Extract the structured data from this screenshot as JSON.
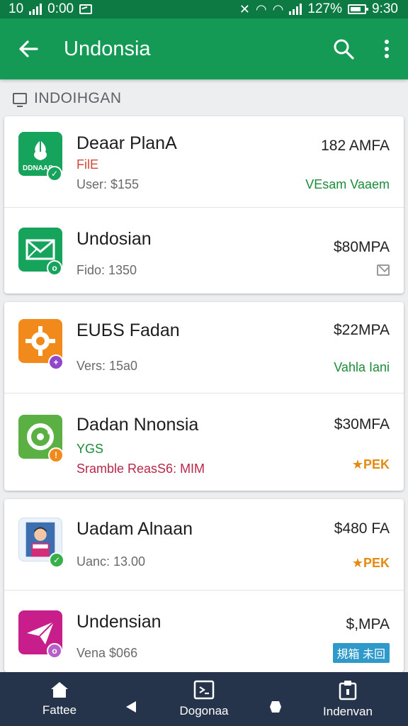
{
  "status_bar": {
    "left_a": "10",
    "left_b": "0:00",
    "battery": "127%",
    "time": "9:30"
  },
  "app_bar": {
    "title": "Undonsia",
    "back_icon": "arrow-left-icon",
    "search_icon": "search-icon",
    "more_icon": "more-vert-icon"
  },
  "section": {
    "label": "INDOIHGAN",
    "icon": "monitor-icon"
  },
  "apps": [
    {
      "name": "Deaar PlanA",
      "logo_text": "DDNAAS",
      "tag": "FilE",
      "detail": "User: $155",
      "price": "182 AMFA",
      "status": "VEsam Vaaem",
      "icon_color": "#16a35b",
      "badge_color": "#16a35b"
    },
    {
      "name": "Undosian",
      "detail": "Fido: 1350",
      "price": "$80MPA",
      "status_icon": "mail-icon",
      "icon_color": "#16a35b",
      "badge_color": "#16a35b"
    },
    {
      "name": "EUБS Fadan",
      "detail": "Vers: 15a0",
      "price": "$22MPA",
      "status": "Vahla Iani",
      "icon_color": "#f28a1b",
      "badge_color": "#9147c9"
    },
    {
      "name": "Dadan Nnonsia",
      "tag": "YGS",
      "detail": "Sramble ReasS6: MIM",
      "price": "$30MFA",
      "status": "★PEK",
      "icon_color": "#5bb043",
      "badge_color": "#f28a1b"
    },
    {
      "name": "Uadam Alnaan",
      "detail": "Uanc: 13.00",
      "price": "$480 FA",
      "status": "★PEK",
      "icon_color": "#e9f1fb",
      "badge_color": "#38b049"
    },
    {
      "name": "Undensian",
      "detail": "Vena $066",
      "price": "$,MPA",
      "status": "規箱 未回",
      "icon_color": "#c81e8c",
      "badge_color": "#b75ec9"
    }
  ],
  "bottom_nav": {
    "home_label": "Fattee",
    "center_label": "Dogonaa",
    "right_label": "Indenvan",
    "home_icon": "home-icon",
    "center_icon": "slides-icon",
    "right_icon": "clipboard-icon"
  },
  "colors": {
    "primary": "#159a55",
    "status_bar": "#0d7a44",
    "nav_bar": "#25344a",
    "accent_green": "#1b8b3a",
    "accent_orange": "#e58a10",
    "accent_red": "#c0392b"
  }
}
